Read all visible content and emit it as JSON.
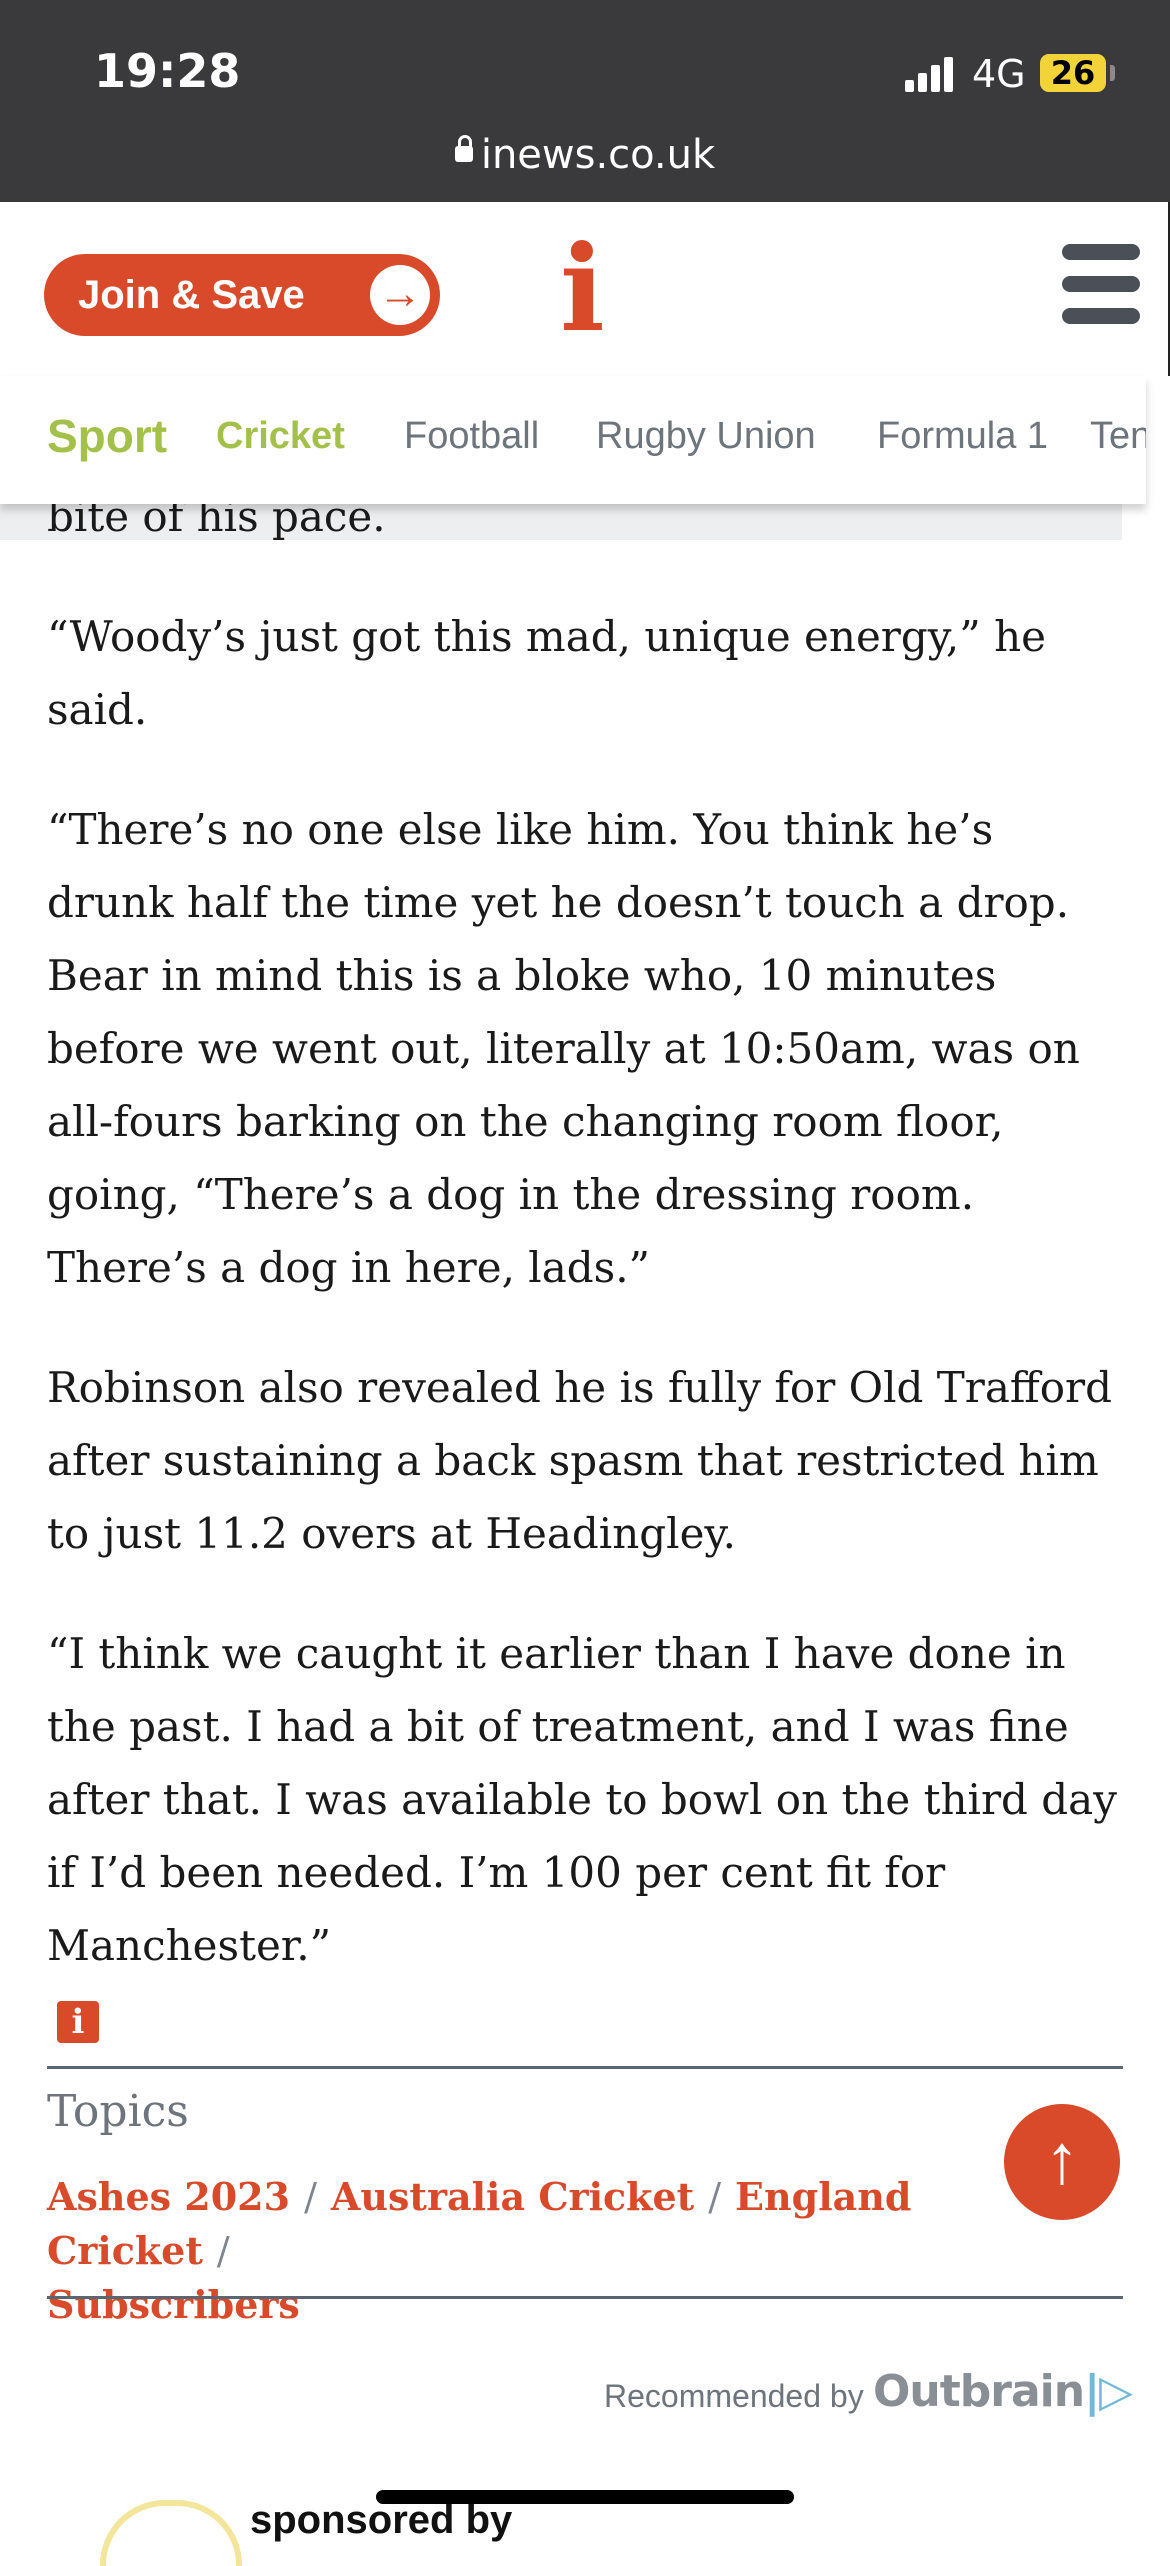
{
  "status_bar": {
    "time": "19:28",
    "network": "4G",
    "battery": "26"
  },
  "browser": {
    "url": "inews.co.uk"
  },
  "header": {
    "join_label": "Join & Save",
    "logo": "i"
  },
  "nav": {
    "items": [
      {
        "label": "Sport"
      },
      {
        "label": "Cricket"
      },
      {
        "label": "Football"
      },
      {
        "label": "Rugby Union"
      },
      {
        "label": "Formula 1"
      },
      {
        "label": "Tennis"
      }
    ]
  },
  "article": {
    "paragraphs": [
      "bite of his pace.",
      "“Woody’s just got this mad, unique energy,” he said.",
      "“There’s no one else like him. You think he’s drunk half the time yet he doesn’t touch a drop. Bear in mind this is a bloke who, 10 minutes before we went out, literally at 10:50am, was on all-fours barking on the changing room floor, going, “There’s a dog in the dressing room. There’s a dog in here, lads.”",
      "Robinson also revealed he is fully for Old Trafford after sustaining a back spasm that restricted him to just 11.2 overs at Headingley.",
      "“I think we caught it earlier than I have done in the past. I had a bit of treatment, and I was fine after that. I was available to bowl on the third day if I’d been needed. I’m 100 per cent fit for Manchester.”"
    ],
    "end_mark": "i"
  },
  "topics": {
    "label": "Topics",
    "items": [
      "Ashes 2023",
      "Australia Cricket",
      "England Cricket",
      "Subscribers"
    ],
    "separator": "/"
  },
  "recommendations": {
    "label": "Recommended by",
    "provider": "Outbrain",
    "sponsored": "sponsored by"
  },
  "colors": {
    "brand": "#d84a2a",
    "nav_active": "#a3c14a",
    "status_bar": "#3a3a3c"
  }
}
